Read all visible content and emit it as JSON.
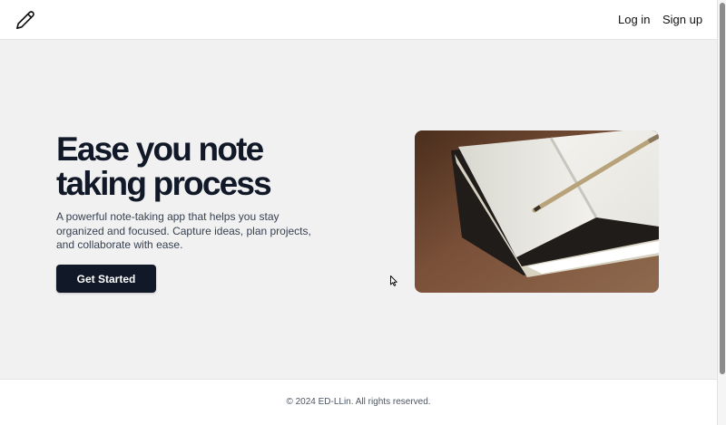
{
  "header": {
    "logo_icon": "pencil-icon",
    "login_label": "Log in",
    "signup_label": "Sign up"
  },
  "hero": {
    "title": "Ease you note taking process",
    "description": "A powerful note-taking app that helps you stay organized and focused. Capture ideas, plan projects, and collaborate with ease.",
    "cta_label": "Get Started",
    "image_subject": "notebook-with-pencil"
  },
  "footer": {
    "copyright": "© 2024 ED-LLin. All rights reserved."
  },
  "colors": {
    "primary": "#111827",
    "background": "#f1f1f1",
    "surface": "#ffffff"
  }
}
